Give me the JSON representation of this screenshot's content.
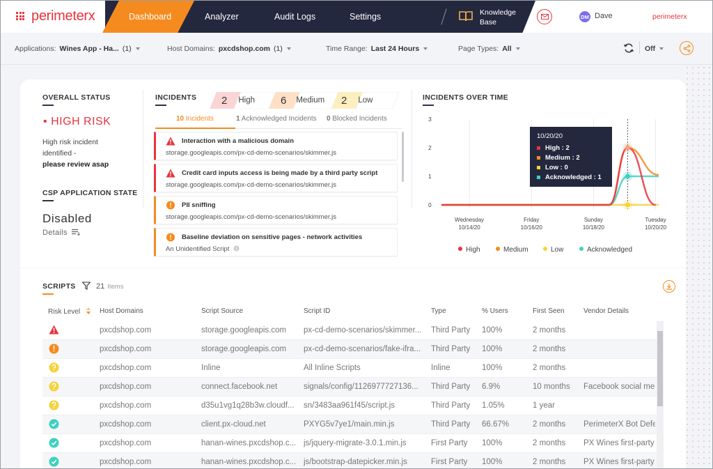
{
  "nav": {
    "logo": "perimeterx",
    "items": [
      "Dashboard",
      "Analyzer",
      "Audit Logs",
      "Settings"
    ],
    "knowledge_base": [
      "Knowledge",
      "Base"
    ],
    "user_initials": "DM",
    "user_name": "Dave",
    "brand": "perimeterx"
  },
  "filters": {
    "applications_label": "Applications:",
    "applications_value": "Wines App - Ha...",
    "applications_count": "(1)",
    "host_label": "Host Domains:",
    "host_value": "pxcdshop.com",
    "host_count": "(1)",
    "time_label": "Time Range:",
    "time_value": "Last 24 Hours",
    "page_label": "Page Types:",
    "page_value": "All",
    "toggle_value": "Off"
  },
  "status": {
    "overall_title": "OVERALL STATUS",
    "risk_bullet": "•",
    "risk": "HIGH RISK",
    "desc_line1": "High risk incident",
    "desc_line2": "identified -",
    "desc_bold": "please review asap",
    "csp_title": "CSP APPLICATION STATE",
    "csp_state": "Disabled",
    "details": "Details"
  },
  "incidents": {
    "title": "INCIDENTS",
    "high_count": "2",
    "high_label": "High",
    "medium_count": "6",
    "medium_label": "Medium",
    "low_count": "2",
    "low_label": "Low",
    "tabs": [
      {
        "count": "10",
        "label": "Incidents"
      },
      {
        "count": "1",
        "label": "Acknowledged Incidents"
      },
      {
        "count": "0",
        "label": "Blocked Incidents"
      }
    ],
    "list": [
      {
        "title": "Interaction with a malicious domain",
        "url": "storage.googleapis.com/px-cd-demo-scenarios/skimmer.js",
        "level": "high"
      },
      {
        "title": "Credit card inputs access is being made by a third party script",
        "url": "storage.googleapis.com/px-cd-demo-scenarios/skimmer.js",
        "level": "high"
      },
      {
        "title": "PII sniffing",
        "url": "storage.googleapis.com/px-cd-demo-scenarios/skimmer.js",
        "level": "medium"
      },
      {
        "title": "Baseline deviation on sensitive pages - network activities",
        "url": "An Unidentified Script",
        "level": "medium"
      }
    ]
  },
  "chart_title": "INCIDENTS OVER TIME",
  "chart_data": {
    "type": "line",
    "x": [
      "10/14/20",
      "10/16/20",
      "10/18/20",
      "10/20/20"
    ],
    "x_weekdays": [
      "Wednesday",
      "Friday",
      "Sunday",
      "Tuesday"
    ],
    "ylim": [
      0,
      3
    ],
    "yticks": [
      "0",
      "1",
      "2",
      "3"
    ],
    "series": [
      {
        "name": "High",
        "color": "#e8343e",
        "points": [
          [
            0,
            0
          ],
          [
            5.4,
            0
          ],
          [
            6.0,
            2
          ],
          [
            6.9,
            0
          ]
        ]
      },
      {
        "name": "Medium",
        "color": "#f58b1f",
        "points": [
          [
            0,
            0
          ],
          [
            5.4,
            0
          ],
          [
            6.0,
            2
          ],
          [
            7.0,
            1.05
          ]
        ]
      },
      {
        "name": "Low",
        "color": "#f5d23c",
        "points": [
          [
            0,
            0
          ],
          [
            7.0,
            0
          ]
        ]
      },
      {
        "name": "Acknowledged",
        "color": "#3fd0c0",
        "points": [
          [
            0,
            0
          ],
          [
            5.4,
            0
          ],
          [
            6.0,
            1
          ],
          [
            7.0,
            1
          ]
        ]
      }
    ],
    "tooltip": {
      "date": "10/20/20",
      "rows": [
        "High : 2",
        "Medium : 2",
        "Low : 0",
        "Acknowledged : 1"
      ]
    },
    "legend": [
      "High",
      "Medium",
      "Low",
      "Acknowledged"
    ],
    "legend_position": "bottom"
  },
  "scripts": {
    "title": "SCRIPTS",
    "count": "21",
    "count_label": "Items",
    "columns": [
      "Risk Level",
      "Host Domains",
      "Script Source",
      "Script ID",
      "Type",
      "% Users",
      "First Seen",
      "Vendor Details"
    ],
    "rows": [
      {
        "risk": "high",
        "host": "pxcdshop.com",
        "source": "storage.googleapis.com",
        "id": "px-cd-demo-scenarios/skimmer...",
        "type": "Third Party",
        "users": "100%",
        "seen": "2 months",
        "vendor": ""
      },
      {
        "risk": "medium",
        "host": "pxcdshop.com",
        "source": "storage.googleapis.com",
        "id": "px-cd-demo-scenarios/fake-ifra...",
        "type": "Third Party",
        "users": "100%",
        "seen": "2 months",
        "vendor": ""
      },
      {
        "risk": "low",
        "host": "pxcdshop.com",
        "source": "Inline",
        "id": "All Inline Scripts",
        "type": "Inline",
        "users": "100%",
        "seen": "2 months",
        "vendor": ""
      },
      {
        "risk": "low",
        "host": "pxcdshop.com",
        "source": "connect.facebook.net",
        "id": "signals/config/1126977727136...",
        "type": "Third Party",
        "users": "6.9%",
        "seen": "10 months",
        "vendor": "Facebook social me"
      },
      {
        "risk": "low",
        "host": "pxcdshop.com",
        "source": "d35u1vg1q28b3w.cloudf...",
        "id": "sn/3483aa961f45/script.js",
        "type": "Third Party",
        "users": "1.05%",
        "seen": "1 year",
        "vendor": ""
      },
      {
        "risk": "ok",
        "host": "pxcdshop.com",
        "source": "client.px-cloud.net",
        "id": "PXYG5v7ye1/main.min.js",
        "type": "Third Party",
        "users": "66.67%",
        "seen": "2 months",
        "vendor": "PerimeterX Bot Defe"
      },
      {
        "risk": "ok",
        "host": "pxcdshop.com",
        "source": "hanan-wines.pxcdshop.c...",
        "id": "js/jquery-migrate-3.0.1.min.js",
        "type": "First Party",
        "users": "100%",
        "seen": "2 months",
        "vendor": "PX Wines first-party"
      },
      {
        "risk": "ok",
        "host": "pxcdshop.com",
        "source": "hanan-wines.pxcdshop.c...",
        "id": "js/bootstrap-datepicker.min.js",
        "type": "First Party",
        "users": "100%",
        "seen": "2 months",
        "vendor": "PX Wines first-party"
      }
    ]
  },
  "colors": {
    "accent": "#f58b1f",
    "danger": "#e8343e",
    "nav_dark": "#24283e",
    "warning": "#f5d23c",
    "success": "#3fd0c0"
  }
}
